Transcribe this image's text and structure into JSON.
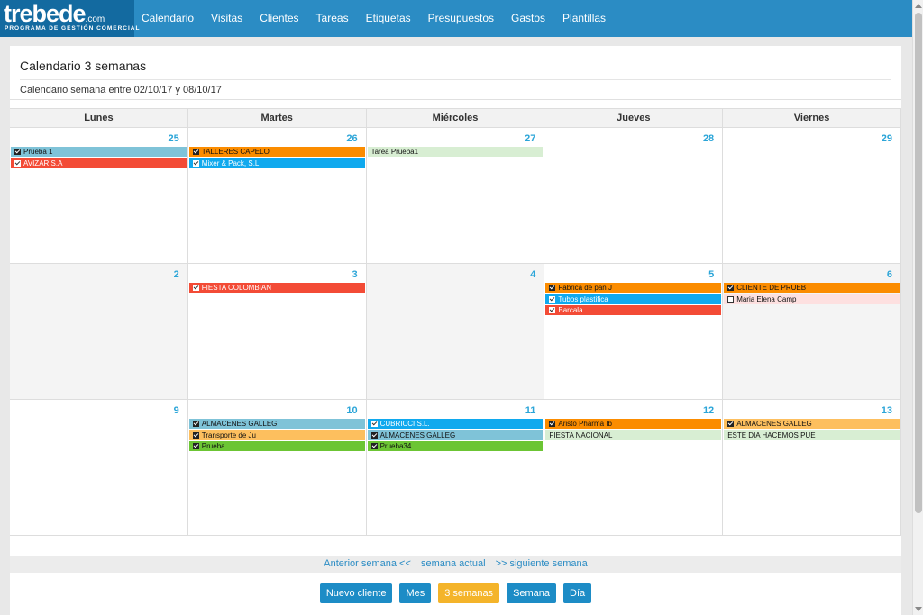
{
  "brand": {
    "logo_main": "trebede",
    "logo_com": ".com",
    "logo_sub": "PROGRAMA DE GESTIÓN COMERCIAL"
  },
  "nav": [
    "Calendario",
    "Visitas",
    "Clientes",
    "Tareas",
    "Etiquetas",
    "Presupuestos",
    "Gastos",
    "Plantillas"
  ],
  "page": {
    "title": "Calendario 3 semanas",
    "subtitle": "Calendario semana entre 02/10/17 y 08/10/17"
  },
  "weekdays": [
    "Lunes",
    "Martes",
    "Miércoles",
    "Jueves",
    "Viernes"
  ],
  "weeks": [
    {
      "days": [
        {
          "num": "25",
          "past": false,
          "events": [
            {
              "label": "Prueba 1",
              "color": "#7fc3d8",
              "check": "dark-on"
            },
            {
              "label": "AVIZAR S.A",
              "color": "#f34b36",
              "check": "light-on"
            }
          ]
        },
        {
          "num": "26",
          "past": false,
          "events": [
            {
              "label": "TALLERES CAPELO",
              "color": "#fb8c00",
              "check": "dark-on"
            },
            {
              "label": "Mixer & Pack, S.L",
              "color": "#10a9ee",
              "check": "light-on"
            }
          ]
        },
        {
          "num": "27",
          "past": false,
          "events": [
            {
              "label": "Tarea Prueba1",
              "color": "#d8eed3",
              "check": "none"
            }
          ]
        },
        {
          "num": "28",
          "past": false,
          "events": []
        },
        {
          "num": "29",
          "past": false,
          "events": []
        }
      ]
    },
    {
      "days": [
        {
          "num": "2",
          "past": true,
          "events": []
        },
        {
          "num": "3",
          "past": false,
          "events": [
            {
              "label": "FIESTA COLOMBIAN",
              "color": "#f34b36",
              "check": "light-on"
            }
          ]
        },
        {
          "num": "4",
          "past": true,
          "events": []
        },
        {
          "num": "5",
          "past": false,
          "events": [
            {
              "label": "Fabrica de pan J",
              "color": "#fb8c00",
              "check": "dark-on"
            },
            {
              "label": "Tubos plastifica",
              "color": "#10a9ee",
              "check": "light-on"
            },
            {
              "label": "Barcala",
              "color": "#f34b36",
              "check": "light-on"
            }
          ]
        },
        {
          "num": "6",
          "past": true,
          "events": [
            {
              "label": "CLIENTE DE PRUEB",
              "color": "#fb8c00",
              "check": "dark-on"
            },
            {
              "label": "Maria Elena Camp",
              "color": "#fde0e0",
              "check": "off"
            }
          ]
        }
      ]
    },
    {
      "days": [
        {
          "num": "9",
          "past": false,
          "events": []
        },
        {
          "num": "10",
          "past": false,
          "events": [
            {
              "label": "ALMACENES GALLEG",
              "color": "#7fc3d8",
              "check": "dark-on"
            },
            {
              "label": "Transporte de Ju",
              "color": "#fdbf5e",
              "check": "dark-on"
            },
            {
              "label": "Prueba",
              "color": "#6cc534",
              "check": "dark-on"
            }
          ]
        },
        {
          "num": "11",
          "past": false,
          "events": [
            {
              "label": "CUBRICCI,S.L.",
              "color": "#10a9ee",
              "check": "light-on"
            },
            {
              "label": "ALMACENES GALLEG",
              "color": "#7fc3d8",
              "check": "dark-on"
            },
            {
              "label": "Prueba34",
              "color": "#6cc534",
              "check": "dark-on"
            }
          ]
        },
        {
          "num": "12",
          "past": false,
          "events": [
            {
              "label": "Aristo Pharma Ib",
              "color": "#fb8c00",
              "check": "dark-on"
            },
            {
              "label": "FIESTA NACIONAL",
              "color": "#d8eed3",
              "check": "none"
            }
          ]
        },
        {
          "num": "13",
          "past": false,
          "events": [
            {
              "label": "ALMACENES GALLEG",
              "color": "#fdbf5e",
              "check": "dark-on"
            },
            {
              "label": "ESTE DIA HACEMOS PUE",
              "color": "#d8eed3",
              "check": "none"
            }
          ]
        }
      ]
    }
  ],
  "week_nav": {
    "prev": "Anterior semana <<",
    "current": "semana actual",
    "next": ">> siguiente semana"
  },
  "buttons": [
    {
      "label": "Nuevo cliente",
      "active": false
    },
    {
      "label": "Mes",
      "active": false
    },
    {
      "label": "3 semanas",
      "active": true
    },
    {
      "label": "Semana",
      "active": false
    },
    {
      "label": "Día",
      "active": false
    }
  ]
}
